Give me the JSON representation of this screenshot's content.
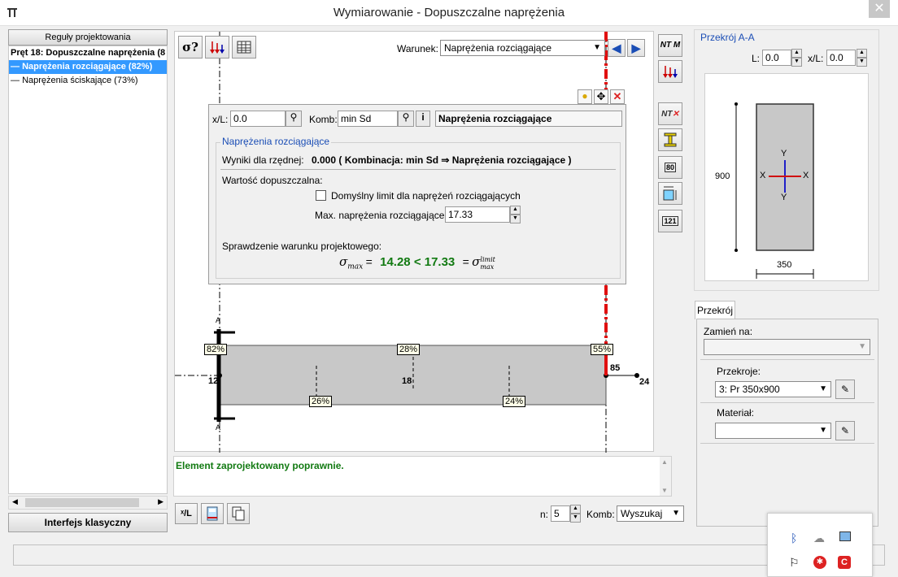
{
  "window": {
    "title": "Wymiarowanie - Dopuszczalne naprężenia",
    "close_glyph": "✕"
  },
  "left": {
    "rules_button": "Reguły projektowania",
    "tree": [
      "Pręt 18: Dopuszczalne naprężenia (8",
      "Naprężenia rozciągające (82%)",
      "Naprężenia ściskające (73%)"
    ],
    "classic_button": "Interfejs klasyczny"
  },
  "toolbar": {
    "sigma_label": "σ?",
    "condition_label": "Warunek:",
    "condition_value": "Naprężenia rozciągające"
  },
  "dialog": {
    "xl_label": "x/L:",
    "xl_value": "0.0",
    "komb_label": "Komb:",
    "komb_value": "min Sd",
    "header": "Naprężenia rozciągające",
    "group_title": "Naprężenia rozciągające",
    "result_label": "Wyniki dla rzędnej:",
    "result_text": "0.000 ( Kombinacja:  min Sd ⇒ Naprężenia rozciągające )",
    "allowed_label": "Wartość dopuszczalna:",
    "default_limit_label": "Domyślny limit dla naprężeń rozciągających",
    "max_label": "Max. naprężenia rozciągające:",
    "max_value": "17.33",
    "check_label": "Sprawdzenie warunku projektowego:",
    "formula_left": "σ",
    "formula_left_sub": "max",
    "formula_eq1": "=",
    "formula_value": "14.28 < 17.33",
    "formula_eq2": "=",
    "formula_right": "σ",
    "formula_right_sup": "limit",
    "formula_right_sub": "max"
  },
  "diagram": {
    "labels": {
      "p82": "82%",
      "p28": "28%",
      "p55": "55%",
      "p26": "26%",
      "p24": "24%"
    },
    "nodes": {
      "n12": "12",
      "n18": "18",
      "n85": "85",
      "n24": "24"
    },
    "section_mark_top": "A",
    "section_mark_bottom": "A"
  },
  "message": "Element zaprojektowany poprawnie.",
  "bottom": {
    "n_label": "n:",
    "n_value": "5",
    "komb_label": "Komb:",
    "komb_value": "Wyszukaj"
  },
  "side_tools": {
    "ntm": "NT M",
    "ntx": "NT",
    "b80": "80",
    "b121": "121"
  },
  "section": {
    "title": "Przekrój A-A",
    "l_label": "L:",
    "l_value": "0.0",
    "xl_label": "x/L:",
    "xl_value": "0.0",
    "height_dim": "900",
    "width_dim": "350",
    "axis_y_top": "Y",
    "axis_y_bottom": "Y",
    "axis_x_left": "X",
    "axis_x_right": "X"
  },
  "tab": {
    "name": "Przekrój",
    "replace_label": "Zamień na:",
    "replace_value": "",
    "sections_label": "Przekroje:",
    "sections_value": "3: Pr 350x900",
    "material_label": "Materiał:",
    "material_value": ""
  },
  "colors": {
    "accent_blue": "#3399ff",
    "ok_green": "#127a12",
    "red_line": "#e01010",
    "section_gray": "#c8c8c8"
  }
}
